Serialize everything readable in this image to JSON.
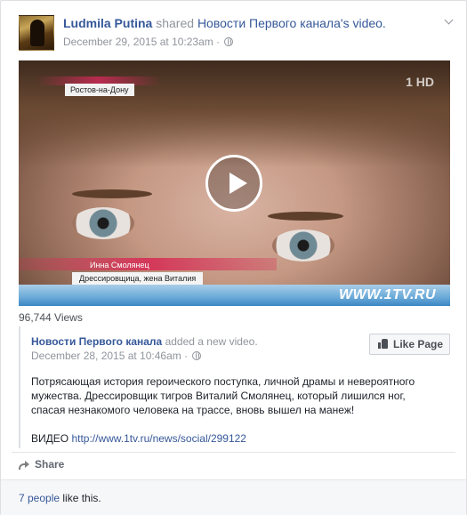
{
  "post": {
    "author": "Ludmila Putina",
    "action": " shared ",
    "shared_owner": "Новости Первого канала",
    "shared_suffix": "'s video.",
    "timestamp": "December 29, 2015 at 10:23am",
    "privacy_icon": "globe-icon",
    "menu_icon": "chevron-down-icon"
  },
  "video": {
    "caption_top": "Ростов-на-Дону",
    "channel_logo": "1 HD",
    "name_line1": "Инна Смолянец",
    "name_line2": "Дрессировщица, жена Виталия",
    "watermark": "WWW.1TV.RU",
    "play_icon": "play-icon",
    "views": "96,744 Views"
  },
  "shared_post": {
    "page_name": "Новости Первого канала",
    "action": " added a new video.",
    "timestamp": "December 28, 2015 at 10:46am",
    "like_page_label": "Like Page",
    "text": "Потрясающая история героического поступка, личной драмы и невероятного мужества. Дрессировщик тигров Виталий Смолянец, который лишился ног, спасая незнакомого человека на трассе, вновь вышел на манеж!",
    "link_prefix": "ВИДЕО ",
    "link": "http://www.1tv.ru/news/social/299122"
  },
  "actions": {
    "share_label": "Share"
  },
  "footer": {
    "likes_link": "7 people",
    "likes_suffix": " like this."
  }
}
